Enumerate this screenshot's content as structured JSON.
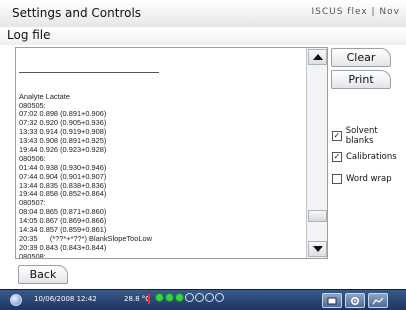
{
  "window": {
    "title": "Settings and Controls",
    "brand": "ISCUS flex | Nov"
  },
  "screen": {
    "subtitle": "Log file"
  },
  "log": {
    "lines": [
      "Analyte Lactate",
      "080505:",
      "07:02 0.898 (0.891+0.906)",
      "07:32 0.920 (0.905+0.936)",
      "13:33 0.914 (0.919+0.908)",
      "13:43 0.908 (0.891+0.925)",
      "19:44 0.926 (0.923+0.928)",
      "080506:",
      "01:44 0.938 (0.930+0.946)",
      "07:44 0.904 (0.901+0.907)",
      "13:44 0.835 (0.838+0.836)",
      "19:44 0.858 (0.852+0.864)",
      "080507:",
      "08:04 0.865 (0.871+0.860)",
      "14:05 0.867 (0.869+0.866)",
      "14:34 0.857 (0.859+0.861)",
      "20:35      (*??*+*??*) BlankSlopeTooLow",
      "20:39 0.843 (0.843+0.844)",
      "080508:",
      "02:39 0.842 (0.838+0.846)",
      "08:23 0.905 (0.897+0.913)"
    ]
  },
  "buttons": {
    "clear": "Clear",
    "print": "Print",
    "back": "Back"
  },
  "options": {
    "solvent_blanks": {
      "label": "Solvent blanks",
      "checked": true
    },
    "calibrations": {
      "label": "Calibrations",
      "checked": true
    },
    "word_wrap": {
      "label": "Word wrap",
      "checked": false
    }
  },
  "taskbar": {
    "datetime": "10/06/2008 12:42",
    "temperature": "28.8 °C",
    "indicators": [
      "on",
      "on",
      "on",
      "off",
      "off",
      "off",
      "off"
    ]
  },
  "colors": {
    "taskbar": "#1d3560",
    "indicator_on": "#38d24a",
    "alert": "#ff2a2a"
  }
}
